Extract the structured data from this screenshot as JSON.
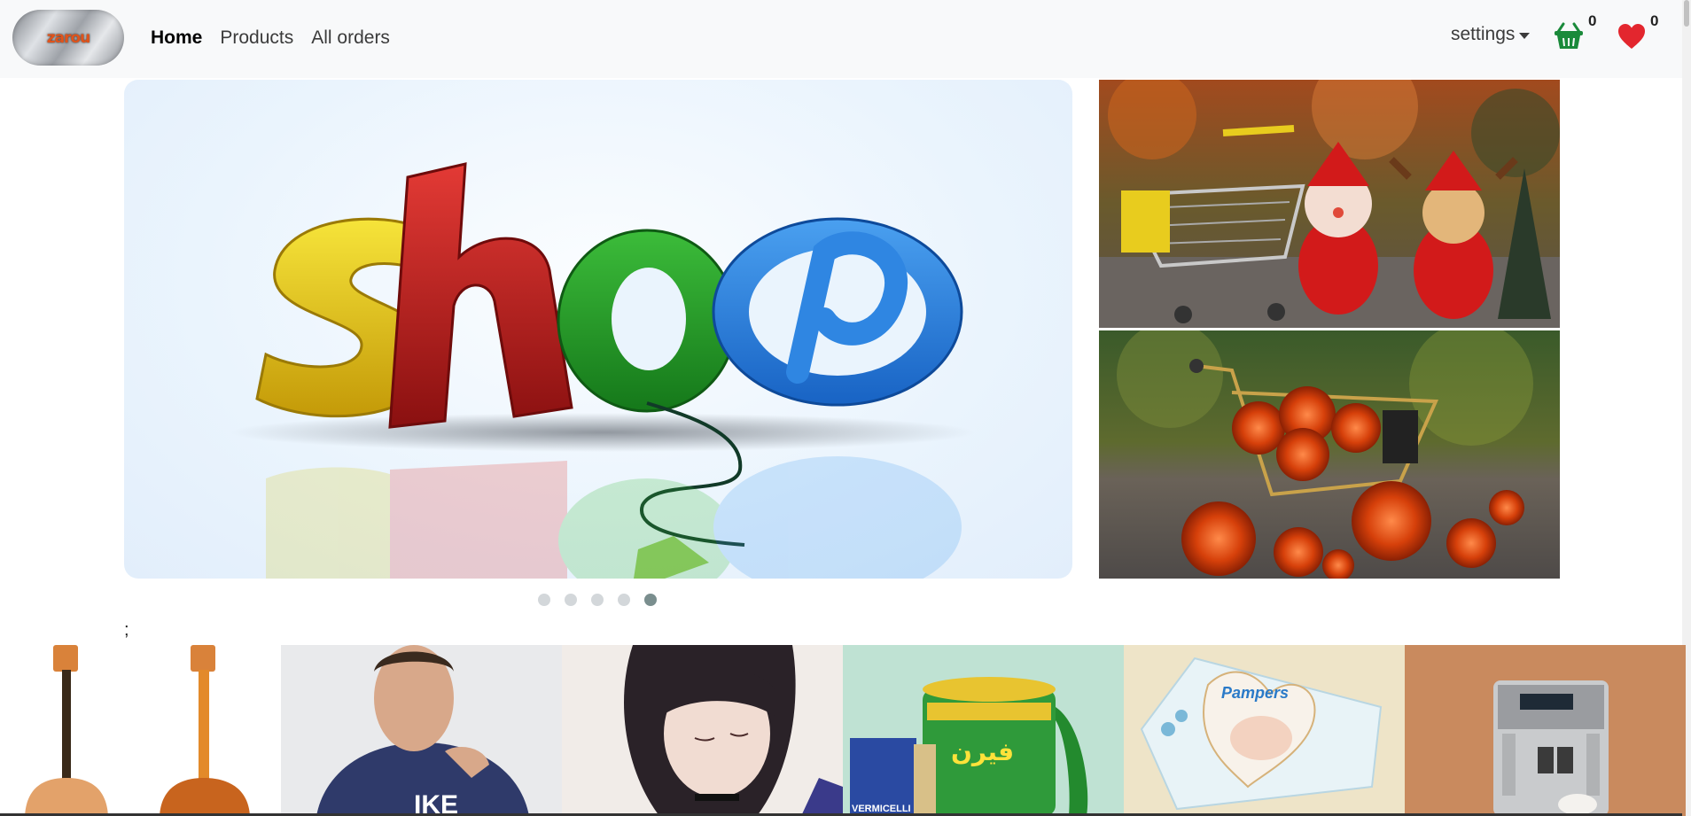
{
  "navbar": {
    "logo_text": "zarou",
    "links": [
      {
        "label": "Home",
        "active": true
      },
      {
        "label": "Products",
        "active": false
      },
      {
        "label": "All orders",
        "active": false
      }
    ],
    "settings_label": "settings",
    "cart_count": "0",
    "wishlist_count": "0"
  },
  "hero": {
    "slide_text": "shop",
    "slides_total": 5,
    "active_slide": 5
  },
  "stray_text": ";",
  "colors": {
    "basket_green": "#1a8a3a",
    "heart_red": "#e3262e",
    "active_dot": "#7a8e8e"
  },
  "products": [
    {
      "name": "guitars"
    },
    {
      "name": "hoodie"
    },
    {
      "name": "anime-art"
    },
    {
      "name": "milk-powder"
    },
    {
      "name": "diapers"
    },
    {
      "name": "coffee-machine"
    }
  ],
  "product_texts": {
    "hoodie_text": "IKE",
    "milk_brand": "فيرن",
    "vermicelli": "VERMICELLI",
    "diaper_brand": "Pampers"
  }
}
